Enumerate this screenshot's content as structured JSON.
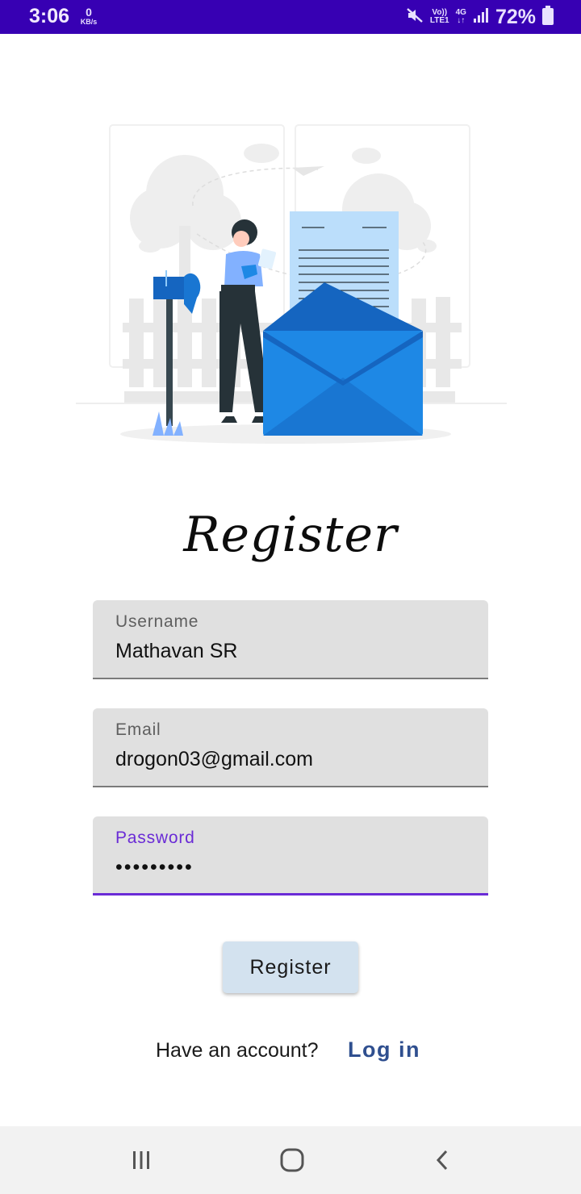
{
  "status_bar": {
    "time": "3:06",
    "net_speed_value": "0",
    "net_speed_unit": "KB/s",
    "volte": "Vo))",
    "lte": "LTE1",
    "network": "4G",
    "battery": "72%",
    "icons": [
      "mute-icon",
      "signal-icon",
      "battery-icon"
    ]
  },
  "title": "Register",
  "form": {
    "username": {
      "label": "Username",
      "value": "Mathavan SR"
    },
    "email": {
      "label": "Email",
      "value": "drogon03@gmail.com"
    },
    "password": {
      "label": "Password",
      "value": "•••••••••"
    }
  },
  "register_button": "Register",
  "footer": {
    "prompt": "Have an account?",
    "login_link": "Log in"
  },
  "nav": {
    "icons": [
      "recents-icon",
      "home-icon",
      "back-icon"
    ]
  },
  "colors": {
    "status_bar": "#3700b3",
    "accent": "#6a2bd6",
    "button": "#d3e2ef",
    "link": "#2f4f8f",
    "field_bg": "#e0e0e0"
  }
}
